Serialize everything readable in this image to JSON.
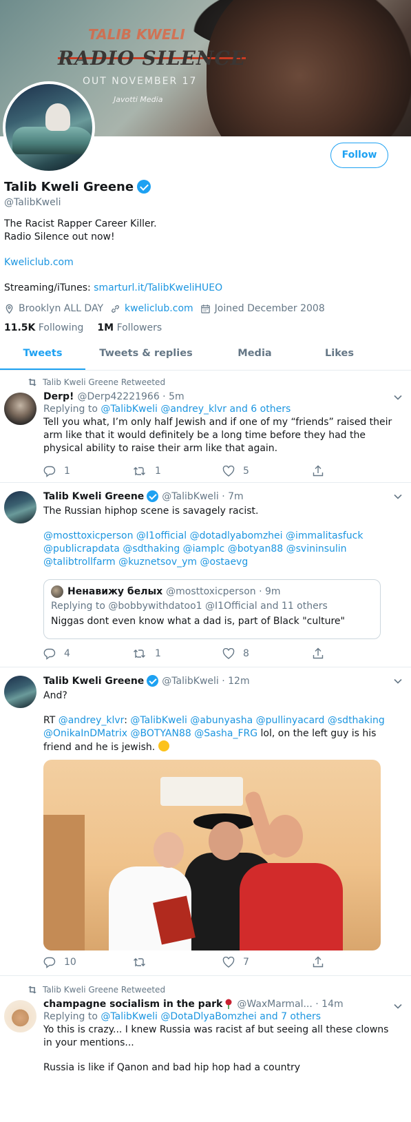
{
  "banner": {
    "graffiti": "TALIB KWELI",
    "album": "RADIO SILENCE",
    "release": "OUT NOVEMBER 17",
    "label": "Javotti Media"
  },
  "profile": {
    "follow_label": "Follow",
    "display_name": "Talib Kweli Greene",
    "handle": "@TalibKweli",
    "bio_line1": "The Racist Rapper Career Killer.",
    "bio_line2": "Radio Silence out now!",
    "website_link": "Kweliclub.com",
    "streaming_label": "Streaming/iTunes: ",
    "streaming_link": "smarturl.it/TalibKweliHUEO",
    "location": "Brooklyn ALL DAY",
    "url": "kweliclub.com",
    "joined": "Joined December 2008",
    "following_count": "11.5K",
    "following_label": "Following",
    "followers_count": "1M",
    "followers_label": "Followers"
  },
  "tabs": [
    {
      "label": "Tweets",
      "active": true
    },
    {
      "label": "Tweets & replies",
      "active": false
    },
    {
      "label": "Media",
      "active": false
    },
    {
      "label": "Likes",
      "active": false
    }
  ],
  "tweets": [
    {
      "retweet_label": "Talib Kweli Greene Retweeted",
      "name": "Derp!",
      "handle_time": "@Derp42221966 · 5m",
      "replying_prefix": "Replying to ",
      "replying_links": "@TalibKweli @andrey_klvr and 6 others",
      "text": "Tell you what, I’m only half Jewish and if one of my “friends” raised their arm like that it would definitely be a long time before they had the physical ability to raise their arm like that again.",
      "replies": "1",
      "retweets": "1",
      "likes": "5"
    },
    {
      "name": "Talib Kweli Greene",
      "handle_time": "@TalibKweli · 7m",
      "text": "The Russian hiphop scene is savagely racist.",
      "mentions": "@mosttoxicperson @I1official @dotadlyabomzhei @immalitasfuck @publicrapdata @sdthaking @iamplc @botyan88 @svininsulin @talibtrollfarm @kuznetsov_ym @ostaevg",
      "quote": {
        "name": "Ненавижу белых",
        "handle_time": "@mosttoxicperson · 9m",
        "replying": "Replying to @bobbywithdatoo1 @I1Official and 11 others",
        "text": "Niggas dont even know what a dad is, part of Black \"culture\""
      },
      "replies": "4",
      "retweets": "1",
      "likes": "8"
    },
    {
      "name": "Talib Kweli Greene",
      "handle_time": "@TalibKweli · 12m",
      "text_line1": "And?",
      "rt_prefix": "RT ",
      "rt_link1": "@andrey_klvr",
      "rt_colon": ": ",
      "rt_mentions": "@TalibKweli @abunyasha @pullinyacard @sdthaking @OnikaInDMatrix @BOTYAN88 @Sasha_FRG",
      "rt_tail": " lol, on the left guy is his friend and he is jewish. ",
      "replies": "10",
      "retweets": "",
      "likes": "7"
    },
    {
      "retweet_label": "Talib Kweli Greene Retweeted",
      "name": "champagne socialism in the park",
      "handle_time": "@WaxMarmal... · 14m",
      "replying_prefix": "Replying to ",
      "replying_links": "@TalibKweli @DotaDlyaBomzhei and 7 others",
      "text_line1": "Yo this is crazy... I knew Russia was racist af but seeing all these clowns in your mentions...",
      "text_line2": "Russia is like if Qanon and bad hip hop had a country"
    }
  ]
}
